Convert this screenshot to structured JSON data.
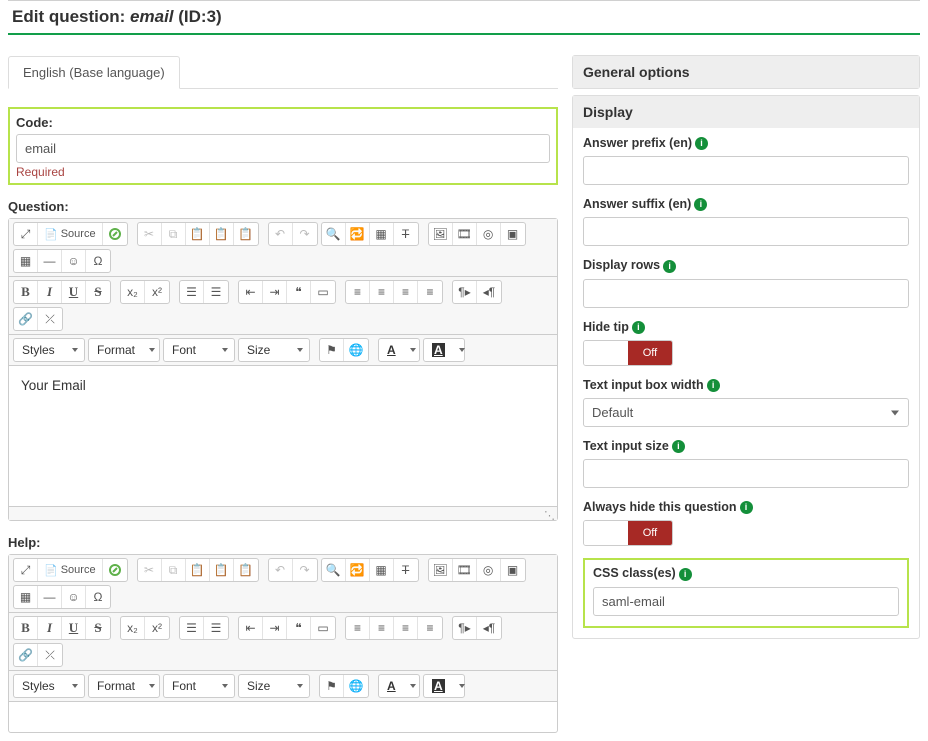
{
  "header": {
    "prefix": "Edit question: ",
    "name": "email",
    "id_label": " (ID:3)"
  },
  "tabs": {
    "english": "English (Base language)"
  },
  "code": {
    "label": "Code:",
    "value": "email",
    "required": "Required"
  },
  "question": {
    "label": "Question:",
    "body": "Your Email"
  },
  "help": {
    "label": "Help:"
  },
  "toolbar": {
    "source": "Source",
    "styles": "Styles",
    "format": "Format",
    "font": "Font",
    "size": "Size",
    "color_a": "A"
  },
  "right": {
    "general": "General options",
    "display": "Display",
    "answer_prefix": "Answer prefix (en)",
    "answer_suffix": "Answer suffix (en)",
    "display_rows": "Display rows",
    "hide_tip": "Hide tip",
    "text_input_box_width": "Text input box width",
    "text_input_box_width_value": "Default",
    "text_input_size": "Text input size",
    "always_hide": "Always hide this question",
    "css_class": "CSS class(es)",
    "css_class_value": "saml-email",
    "off": "Off"
  }
}
